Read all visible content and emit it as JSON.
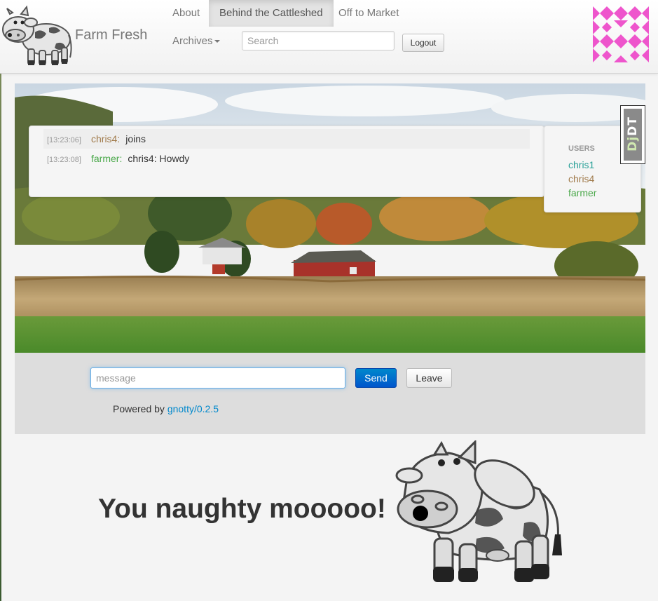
{
  "header": {
    "brand": "Farm Fresh",
    "nav": [
      "About",
      "Behind the Cattleshed",
      "Off to Market"
    ],
    "active_nav_index": 1,
    "archives_label": "Archives",
    "search_placeholder": "Search",
    "logout_label": "Logout",
    "identicon_color": "#ee55cc"
  },
  "chat": {
    "messages": [
      {
        "time": "[13:23:06]",
        "nick": "chris4:",
        "text": "joins",
        "nick_color": "#a07a4a"
      },
      {
        "time": "[13:23:08]",
        "nick": "farmer:",
        "text": "chris4: Howdy",
        "nick_color": "#4aa84a"
      }
    ],
    "users_title": "USERS",
    "users": [
      {
        "name": "chris1",
        "color": "#2aa198"
      },
      {
        "name": "chris4",
        "color": "#a07a4a"
      },
      {
        "name": "farmer",
        "color": "#4aa84a"
      }
    ]
  },
  "djdt": {
    "label": "DjDT"
  },
  "composer": {
    "placeholder": "message",
    "send_label": "Send",
    "leave_label": "Leave",
    "powered_prefix": "Powered by",
    "powered_link": "gnotty/0.2.5"
  },
  "footer": {
    "tagline": "You naughty mooooo!"
  },
  "colors": {
    "link": "#0088cc",
    "send_button": "#0066cc",
    "input_bar": "#dddddd"
  }
}
